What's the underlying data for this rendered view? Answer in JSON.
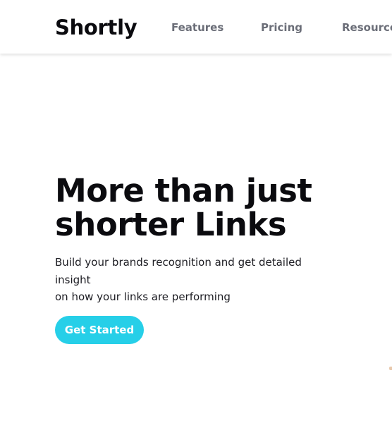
{
  "header": {
    "logo": "Shortly",
    "nav": [
      {
        "label": "Features"
      },
      {
        "label": "Pricing"
      },
      {
        "label": "Resources"
      }
    ]
  },
  "hero": {
    "title_line1": "More than just",
    "title_line2": "shorter Links",
    "subtitle_line1": "Build your brands recognition and get detailed insight",
    "subtitle_line2": "on how your links are performing",
    "cta_label": "Get Started"
  },
  "colors": {
    "accent": "#26cfe8",
    "heading": "#0b0b0f",
    "nav_text": "#6b6e78",
    "body_text": "#1c1c22",
    "background": "#ffffff"
  }
}
